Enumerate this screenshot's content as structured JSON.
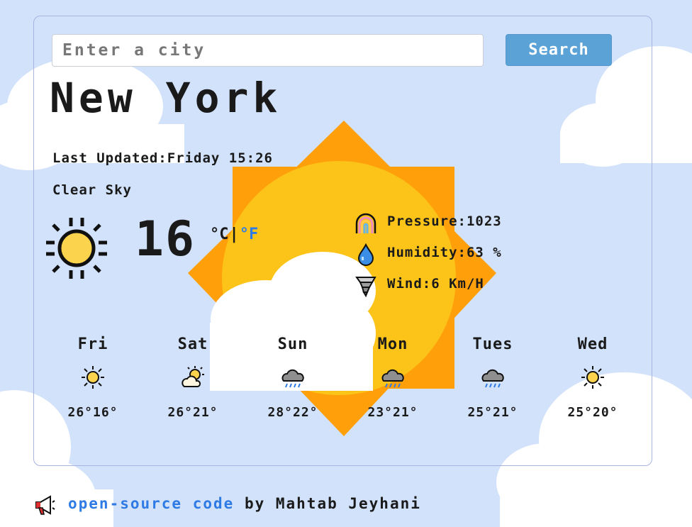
{
  "search": {
    "placeholder": "Enter a city",
    "value": "",
    "button_label": "Search"
  },
  "city": "New York",
  "last_updated": "Last Updated:Friday 15:26",
  "description": "Clear Sky",
  "current": {
    "temperature": "16",
    "unit_c": "°C",
    "unit_sep": "|",
    "unit_f": "°F",
    "icon": "sun-icon"
  },
  "stats": [
    {
      "text": "Pressure:1023",
      "icon": "rainbow-icon"
    },
    {
      "text": "Humidity:63 %",
      "icon": "droplet-icon"
    },
    {
      "text": "Wind:6 Km/H",
      "icon": "tornado-icon"
    }
  ],
  "forecast": [
    {
      "day": "Fri",
      "temps": "26°16°",
      "icon": "sun-icon"
    },
    {
      "day": "Sat",
      "temps": "26°21°",
      "icon": "partly-cloudy-icon"
    },
    {
      "day": "Sun",
      "temps": "28°22°",
      "icon": "rain-cloud-icon"
    },
    {
      "day": "Mon",
      "temps": "23°21°",
      "icon": "rain-cloud-icon"
    },
    {
      "day": "Tues",
      "temps": "25°21°",
      "icon": "rain-cloud-icon"
    },
    {
      "day": "Wed",
      "temps": "25°20°",
      "icon": "sun-icon"
    }
  ],
  "footer": {
    "link_text": "open-source code",
    "credit": " by Mahtab Jeyhani",
    "icon": "megaphone-icon"
  },
  "colors": {
    "background": "#d2e2fb",
    "search_button": "#5ba2d7",
    "link": "#2f7be6",
    "sun_orange": "#ff9f0a",
    "sun_yellow": "#fcc419"
  }
}
